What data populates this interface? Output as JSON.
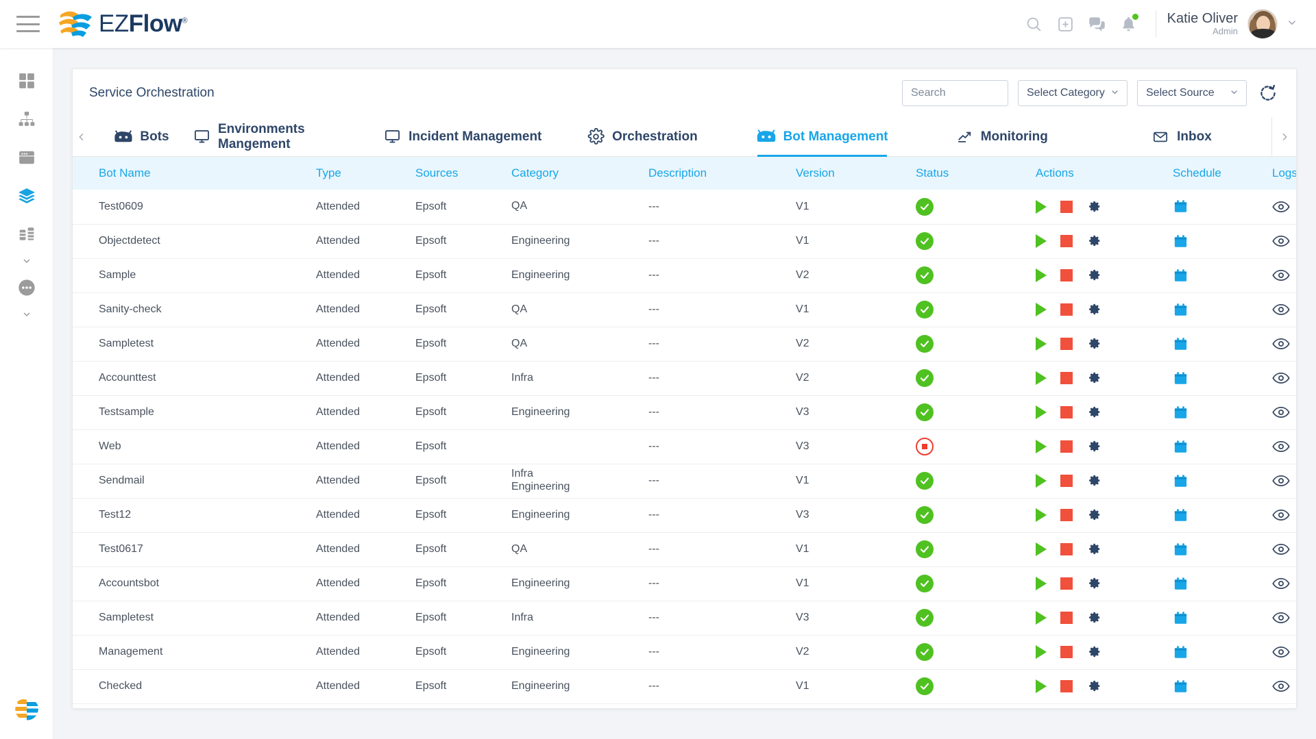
{
  "brand": {
    "ez": "EZ",
    "flow": "Flow",
    "reg": "®"
  },
  "topbar": {
    "icons": [
      "search-icon",
      "add-box-icon",
      "chat-icon",
      "bell-icon"
    ],
    "user_name": "Katie Oliver",
    "user_role": "Admin"
  },
  "sidebar": {
    "items": [
      {
        "name": "dashboard-grid-icon",
        "active": false
      },
      {
        "name": "sitemap-icon",
        "active": false
      },
      {
        "name": "window-icon",
        "active": false
      },
      {
        "name": "layers-icon",
        "active": true
      },
      {
        "name": "server-icon",
        "active": false,
        "chevron": true
      },
      {
        "name": "more-dots-icon",
        "active": false,
        "chevron": true
      }
    ]
  },
  "card": {
    "title": "Service Orchestration",
    "search_placeholder": "Search",
    "search_value": "",
    "category_select": "Select Category",
    "source_select": "Select Source",
    "refresh_label": "refresh-icon"
  },
  "tabs": [
    {
      "label": "Bots",
      "icon": "android-bot-icon",
      "active": false
    },
    {
      "label": "Environments Mangement",
      "icon": "monitor-icon",
      "active": false
    },
    {
      "label": "Incident Management",
      "icon": "monitor-icon",
      "active": false
    },
    {
      "label": "Orchestration",
      "icon": "gear-icon",
      "active": false
    },
    {
      "label": "Bot Management",
      "icon": "android-bot-icon",
      "active": true
    },
    {
      "label": "Monitoring",
      "icon": "trend-up-icon",
      "active": false
    },
    {
      "label": "Inbox",
      "icon": "envelope-icon",
      "active": false
    }
  ],
  "table": {
    "columns": [
      "Bot Name",
      "Type",
      "Sources",
      "Category",
      "Description",
      "Version",
      "Status",
      "Actions",
      "Schedule",
      "Logs"
    ],
    "rows": [
      {
        "name": "Test0609",
        "type": "Attended",
        "source": "Epsoft",
        "category": "QA",
        "description": "---",
        "version": "V1",
        "status": "running"
      },
      {
        "name": "Objectdetect",
        "type": "Attended",
        "source": "Epsoft",
        "category": "Engineering",
        "description": "---",
        "version": "V1",
        "status": "running"
      },
      {
        "name": "Sample",
        "type": "Attended",
        "source": "Epsoft",
        "category": "Engineering",
        "description": "---",
        "version": "V2",
        "status": "running"
      },
      {
        "name": "Sanity-check",
        "type": "Attended",
        "source": "Epsoft",
        "category": "QA",
        "description": "---",
        "version": "V1",
        "status": "running"
      },
      {
        "name": "Sampletest",
        "type": "Attended",
        "source": "Epsoft",
        "category": "QA",
        "description": "---",
        "version": "V2",
        "status": "running"
      },
      {
        "name": "Accounttest",
        "type": "Attended",
        "source": "Epsoft",
        "category": "Infra",
        "description": "---",
        "version": "V2",
        "status": "running"
      },
      {
        "name": "Testsample",
        "type": "Attended",
        "source": "Epsoft",
        "category": "Engineering",
        "description": "---",
        "version": "V3",
        "status": "running"
      },
      {
        "name": "Web",
        "type": "Attended",
        "source": "Epsoft",
        "category": "",
        "description": "---",
        "version": "V3",
        "status": "stopped"
      },
      {
        "name": "Sendmail",
        "type": "Attended",
        "source": "Epsoft",
        "category": "Infra\nEngineering",
        "description": "---",
        "version": "V1",
        "status": "running"
      },
      {
        "name": "Test12",
        "type": "Attended",
        "source": "Epsoft",
        "category": "Engineering",
        "description": "---",
        "version": "V3",
        "status": "running"
      },
      {
        "name": "Test0617",
        "type": "Attended",
        "source": "Epsoft",
        "category": "QA",
        "description": "---",
        "version": "V1",
        "status": "running"
      },
      {
        "name": "Accountsbot",
        "type": "Attended",
        "source": "Epsoft",
        "category": "Engineering",
        "description": "---",
        "version": "V1",
        "status": "running"
      },
      {
        "name": "Sampletest",
        "type": "Attended",
        "source": "Epsoft",
        "category": "Infra",
        "description": "---",
        "version": "V3",
        "status": "running"
      },
      {
        "name": "Management",
        "type": "Attended",
        "source": "Epsoft",
        "category": "Engineering",
        "description": "---",
        "version": "V2",
        "status": "running"
      },
      {
        "name": "Checked",
        "type": "Attended",
        "source": "Epsoft",
        "category": "Engineering",
        "description": "---",
        "version": "V1",
        "status": "running"
      }
    ],
    "action_icons": [
      "play-icon",
      "stop-icon",
      "gear-icon"
    ],
    "schedule_icon": "calendar-icon",
    "logs_icon": "eye-icon"
  },
  "colors": {
    "brand_blue": "#18a6e8",
    "brand_navy": "#2e4668",
    "brand_orange": "#f5a623",
    "status_running": "#4fc120",
    "status_stopped": "#f03c2e",
    "header_bg": "#e9f6fd"
  }
}
